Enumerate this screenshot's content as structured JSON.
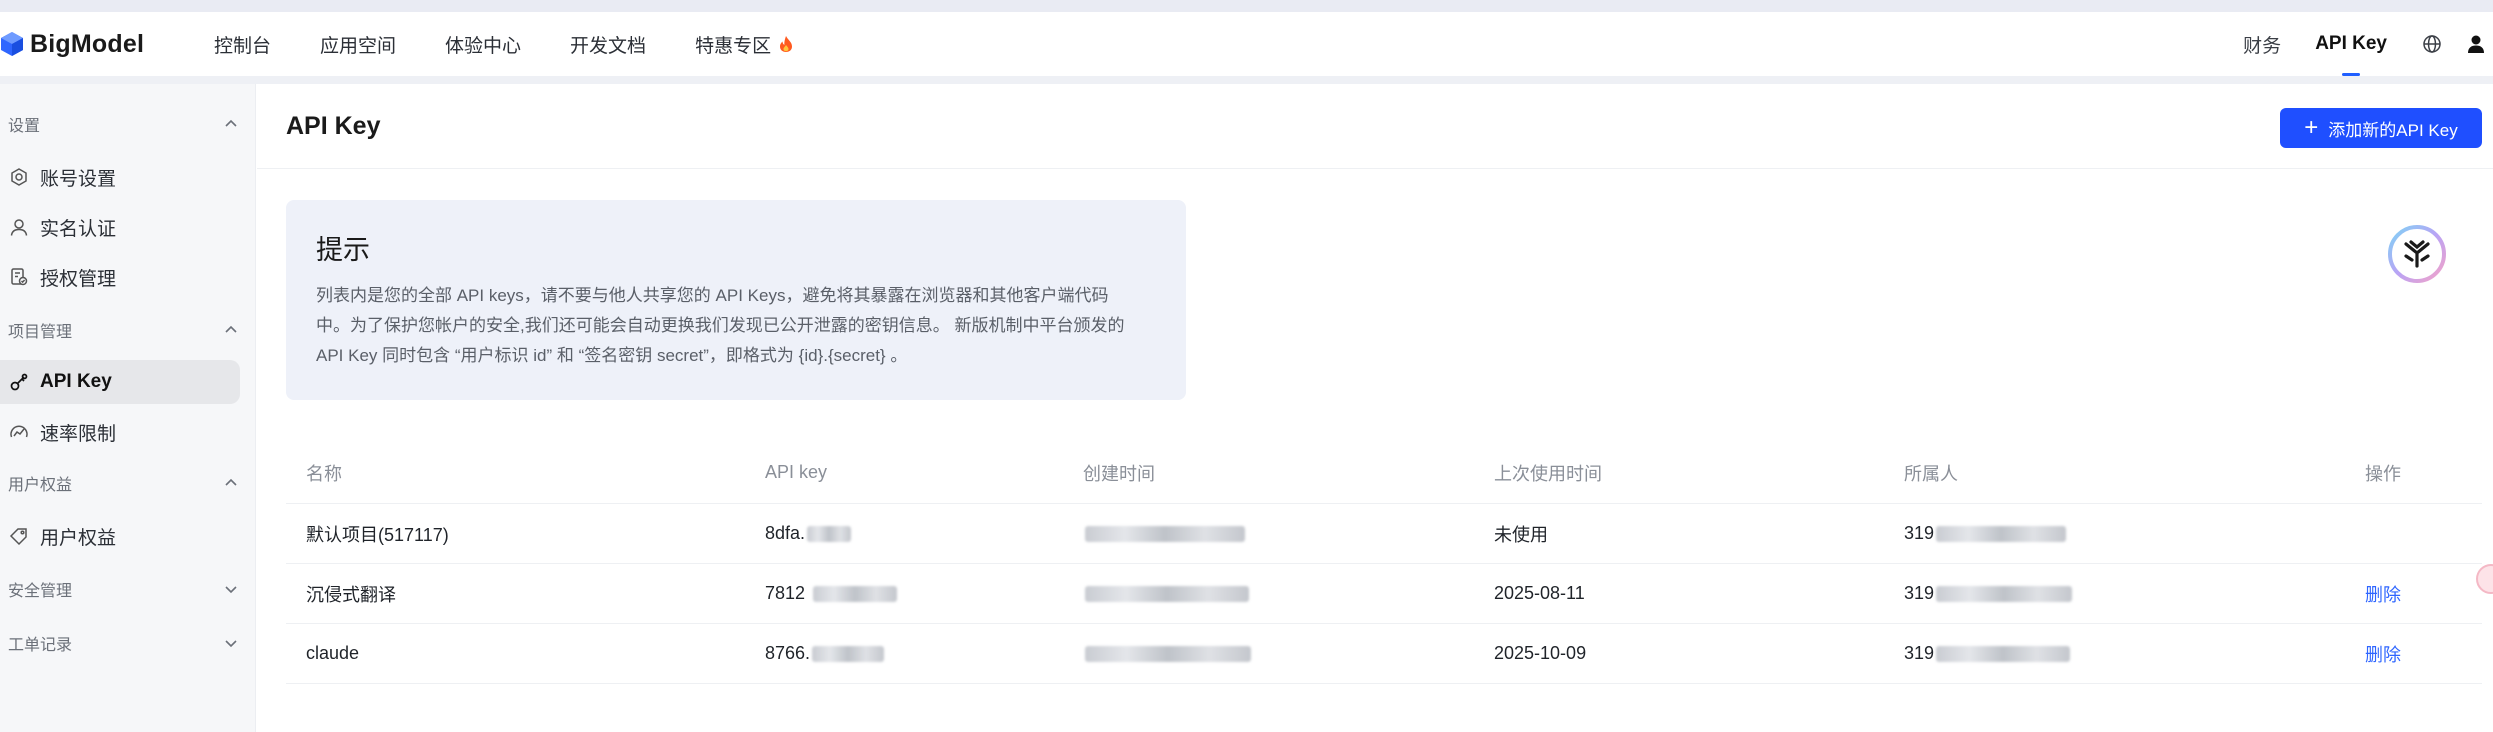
{
  "brand": {
    "name": "BigModel",
    "accent": "#1f4fff"
  },
  "topnav": {
    "items": [
      "控制台",
      "应用空间",
      "体验中心",
      "开发文档",
      "特惠专区"
    ],
    "right": {
      "finance": "财务",
      "apikey": "API Key"
    }
  },
  "sidebar": {
    "sections": [
      {
        "title": "设置",
        "items": [
          "账号设置",
          "实名认证",
          "授权管理"
        ]
      },
      {
        "title": "项目管理",
        "items": [
          "API Key",
          "速率限制"
        ]
      },
      {
        "title": "用户权益",
        "items": [
          "用户权益"
        ]
      },
      {
        "title": "安全管理",
        "items": []
      },
      {
        "title": "工单记录",
        "items": []
      }
    ]
  },
  "main": {
    "title": "API Key",
    "add_button": "添加新的API Key",
    "tip": {
      "title": "提示",
      "line1": "列表内是您的全部 API keys，请不要与他人共享您的 API Keys，避免将其暴露在浏览器和其他客户端代码",
      "line2": "中。为了保护您帐户的安全,我们还可能会自动更换我们发现已公开泄露的密钥信息。 新版机制中平台颁发的",
      "line3": "API Key 同时包含 “用户标识 id” 和 “签名密钥 secret”，即格式为 {id}.{secret} 。"
    },
    "table": {
      "headers": [
        "名称",
        "API key",
        "创建时间",
        "上次使用时间",
        "所属人",
        "操作"
      ],
      "rows": [
        {
          "name": "默认项目(517117)",
          "key_prefix": "8dfa.",
          "last_used": "未使用",
          "owner_prefix": "319",
          "action": ""
        },
        {
          "name": "沉侵式翻译",
          "key_prefix": "7812",
          "last_used": "2025-08-11",
          "owner_prefix": "319",
          "action": "删除"
        },
        {
          "name": "claude",
          "key_prefix": "8766.",
          "last_used": "2025-10-09",
          "owner_prefix": "319",
          "action": "删除"
        }
      ]
    }
  }
}
